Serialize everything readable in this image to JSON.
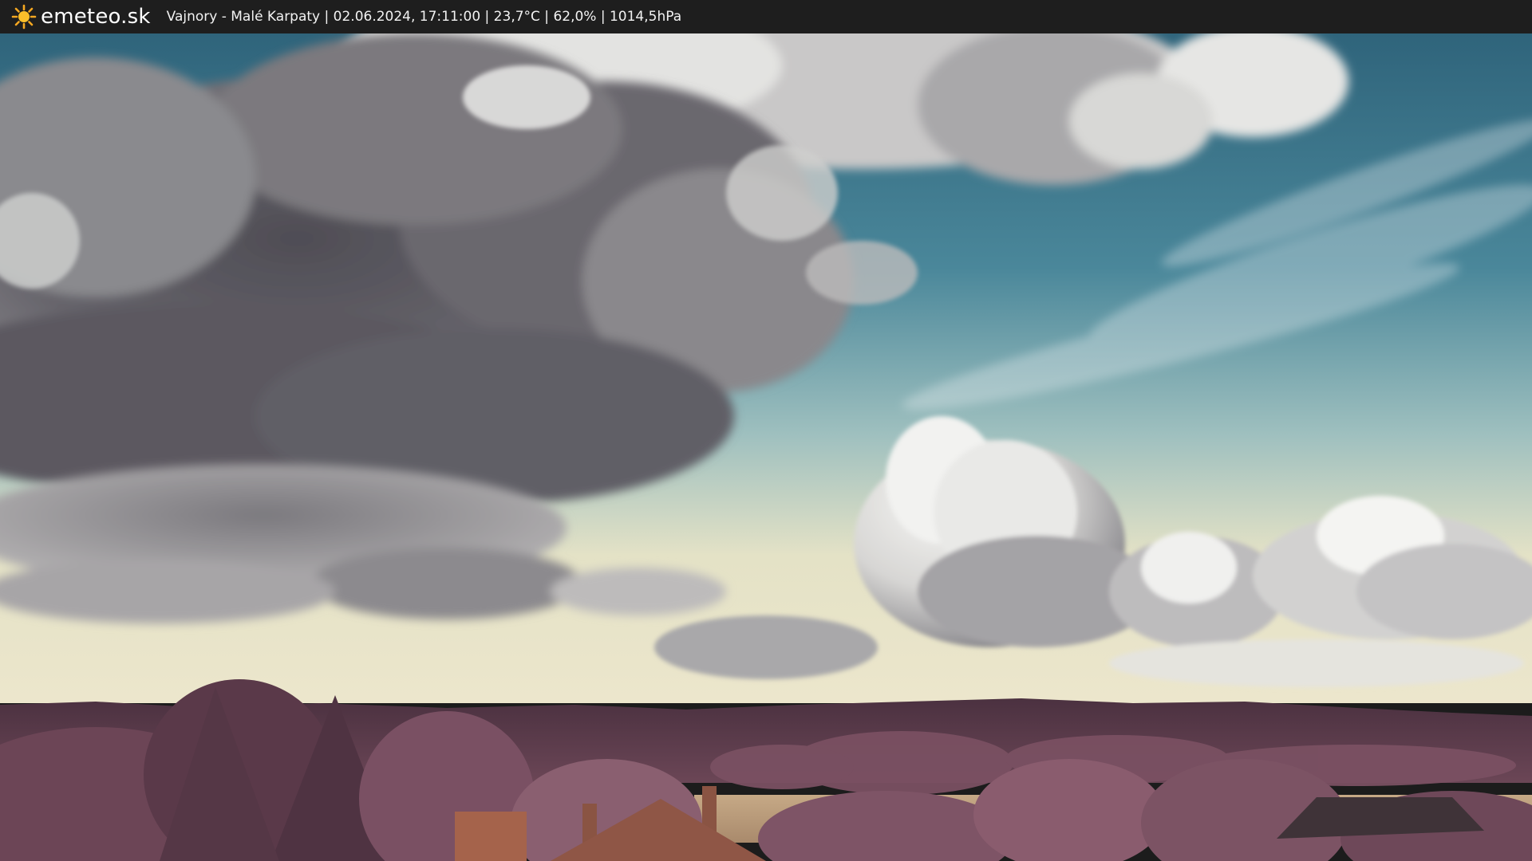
{
  "header": {
    "brand": "emeteo.sk",
    "logo_icon": "sun-icon",
    "station": "Vajnory - Malé Karpaty",
    "datetime": "02.06.2024, 17:11:00",
    "temperature": "23,7°C",
    "humidity": "62,0%",
    "pressure": "1014,5hPa",
    "info_line": "Vajnory - Malé Karpaty | 02.06.2024, 17:11:00 | 23,7°C | 62,0% | 1014,5hPa"
  },
  "webcam": {
    "scene": "webcam-image",
    "colors": {
      "sky_top": "#3d7186",
      "sky_horizon": "#e4e2c6",
      "cloud_dark": "#5d5c63",
      "cloud_light": "#eeeeee",
      "hills": "#5e3f4f",
      "trees": "#7e5463",
      "field": "#bca07d"
    }
  }
}
